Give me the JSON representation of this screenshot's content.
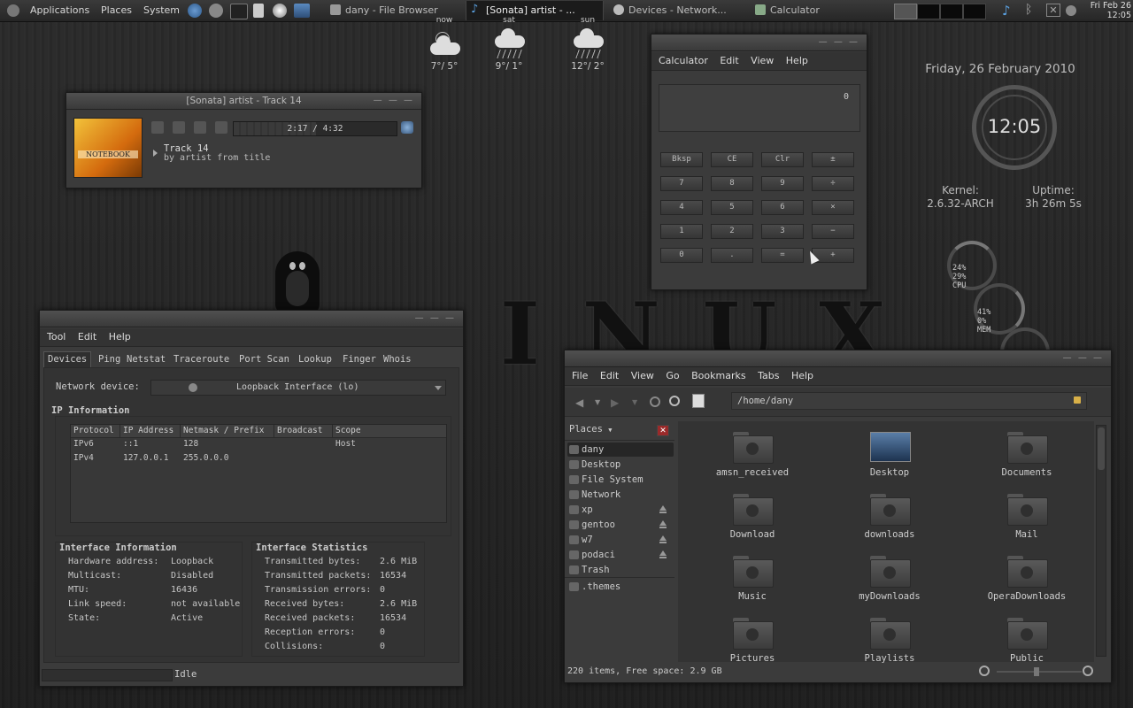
{
  "panel": {
    "menus": [
      "Applications",
      "Places",
      "System"
    ],
    "tasks": [
      {
        "label": "dany - File Browser"
      },
      {
        "label": "[Sonata] artist - ..."
      },
      {
        "label": "Devices - Network..."
      },
      {
        "label": "Calculator"
      }
    ],
    "clock_line1": "Fri Feb 26",
    "clock_line2": "12:05"
  },
  "weather": [
    {
      "day": "now",
      "temp": "7°/ 5°",
      "icon": "cloud-sun-icon"
    },
    {
      "day": "sat",
      "temp": "9°/ 1°",
      "icon": "cloud-rain-icon"
    },
    {
      "day": "sun",
      "temp": "12°/ 2°",
      "icon": "cloud-rain-icon"
    }
  ],
  "desktop": {
    "date": "Friday, 26 February 2010",
    "clock": "12:05",
    "kernel_label": "Kernel:",
    "kernel_value": "2.6.32-ARCH",
    "uptime_label": "Uptime:",
    "uptime_value": "3h 26m 5s",
    "cpu": {
      "line1": "24%",
      "line2": "29%",
      "label": "CPU"
    },
    "mem": {
      "line1": "41%",
      "line2": "0%",
      "label": "MEM"
    },
    "wallpaper_letters": [
      "I",
      "N",
      "U",
      "X"
    ]
  },
  "sonata": {
    "title": "[Sonata] artist - Track 14",
    "time": "2:17 / 4:32",
    "track": "Track 14",
    "byline": "by artist from title",
    "cover_text": "NOTEBOOK",
    "progress": 0.505
  },
  "calculator": {
    "menus": [
      "Calculator",
      "Edit",
      "View",
      "Help"
    ],
    "display": "0",
    "buttons": [
      [
        "Bksp",
        "CE",
        "Clr",
        "±"
      ],
      [
        "7",
        "8",
        "9",
        "÷"
      ],
      [
        "4",
        "5",
        "6",
        "×"
      ],
      [
        "1",
        "2",
        "3",
        "−"
      ],
      [
        "0",
        ".",
        "=",
        "+"
      ]
    ]
  },
  "network": {
    "menus": [
      "Tool",
      "Edit",
      "Help"
    ],
    "tabs": [
      "Devices",
      "Ping",
      "Netstat",
      "Traceroute",
      "Port Scan",
      "Lookup",
      "Finger",
      "Whois"
    ],
    "device_label": "Network device:",
    "device_value": "Loopback Interface (lo)",
    "ip_section": "IP Information",
    "ip_headers": [
      "Protocol",
      "IP Address",
      "Netmask / Prefix",
      "Broadcast",
      "Scope"
    ],
    "ip_rows": [
      [
        "IPv6",
        "::1",
        "128",
        "",
        "Host"
      ],
      [
        "IPv4",
        "127.0.0.1",
        "255.0.0.0",
        "",
        ""
      ]
    ],
    "iface_info_title": "Interface Information",
    "iface_info": [
      {
        "k": "Hardware address:",
        "v": "Loopback"
      },
      {
        "k": "Multicast:",
        "v": "Disabled"
      },
      {
        "k": "MTU:",
        "v": "16436"
      },
      {
        "k": "Link speed:",
        "v": "not available"
      },
      {
        "k": "State:",
        "v": "Active"
      }
    ],
    "iface_stats_title": "Interface Statistics",
    "iface_stats": [
      {
        "k": "Transmitted bytes:",
        "v": "2.6 MiB"
      },
      {
        "k": "Transmitted packets:",
        "v": "16534"
      },
      {
        "k": "Transmission errors:",
        "v": "0"
      },
      {
        "k": "Received bytes:",
        "v": "2.6 MiB"
      },
      {
        "k": "Received packets:",
        "v": "16534"
      },
      {
        "k": "Reception errors:",
        "v": "0"
      },
      {
        "k": "Collisions:",
        "v": "0"
      }
    ],
    "status": "Idle"
  },
  "filebrowser": {
    "menus": [
      "File",
      "Edit",
      "View",
      "Go",
      "Bookmarks",
      "Tabs",
      "Help"
    ],
    "path": "/home/dany",
    "places_label": "Places",
    "places": [
      {
        "name": "dany",
        "eject": false
      },
      {
        "name": "Desktop",
        "eject": false
      },
      {
        "name": "File System",
        "eject": false
      },
      {
        "name": "Network",
        "eject": false
      },
      {
        "name": "xp",
        "eject": true
      },
      {
        "name": "gentoo",
        "eject": true
      },
      {
        "name": "w7",
        "eject": true
      },
      {
        "name": "podaci",
        "eject": true
      },
      {
        "name": "Trash",
        "eject": false
      }
    ],
    "bookmark": ".themes",
    "files": [
      "amsn_received",
      "Desktop",
      "Documents",
      "Download",
      "downloads",
      "Mail",
      "Music",
      "myDownloads",
      "OperaDownloads",
      "Pictures",
      "Playlists",
      "Public"
    ],
    "status": "220 items, Free space: 2.9 GB"
  }
}
